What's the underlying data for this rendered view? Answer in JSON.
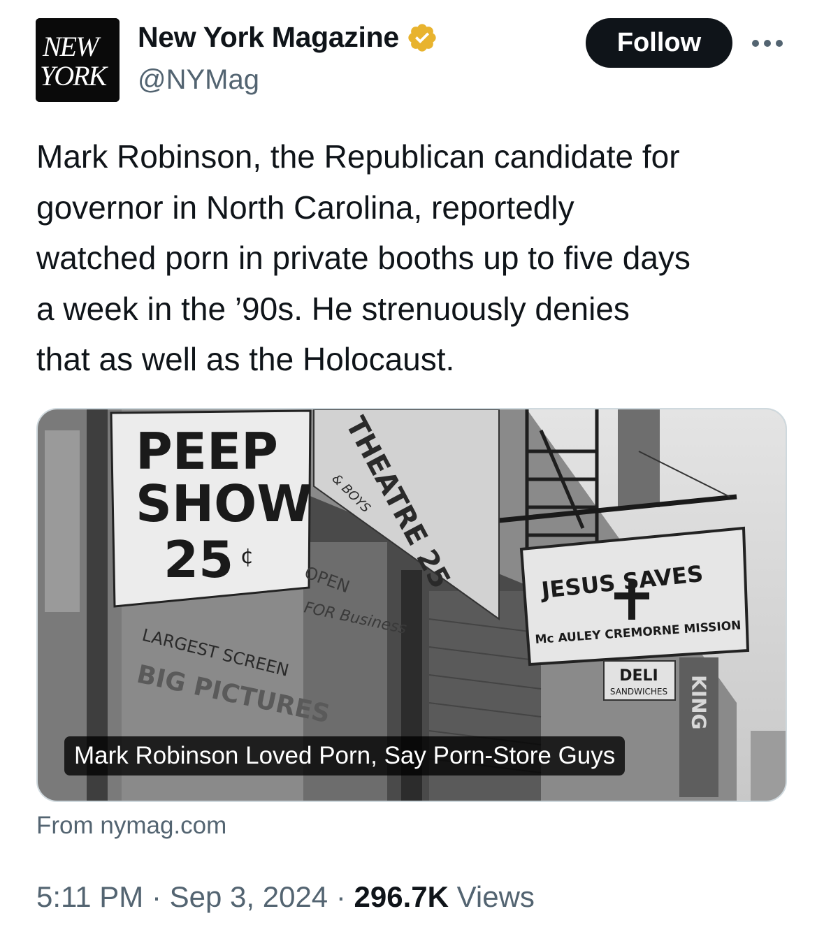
{
  "tweet": {
    "author": {
      "display_name": "New York Magazine",
      "handle": "@NYMag",
      "verified_badge": "gold-verified-badge-icon",
      "avatar_logo_text": "NEW YORK"
    },
    "follow_label": "Follow",
    "more_icon": "more-horizontal-icon",
    "text": "Mark Robinson, the Republican candidate for\ngovernor in North Carolina, reportedly\nwatched porn in private booths up to five days\na week in the ’90s. He strenuously denies\nthat as well as the Holocaust.",
    "card": {
      "headline": "Mark Robinson Loved Porn, Say Porn-Store Guys",
      "source": "From nymag.com",
      "photo_signs": {
        "peep_show": [
          "PEEP",
          "SHOW",
          "25"
        ],
        "cent_symbol": "¢",
        "theatre": "THEATRE 25",
        "boys": "& BOYS",
        "open_for": "OPEN",
        "for_business": "FOR Business",
        "largest_screen": "LARGEST SCREEN",
        "big_pictures": "BIG PICTURES",
        "jesus_saves": "JESUS SAVES",
        "mission": "Mc AULEY CREMORNE MISSION",
        "deli": "DELI",
        "sandwiches": "SANDWICHES",
        "king": "KING"
      }
    },
    "meta": {
      "time": "5:11 PM",
      "separator": "·",
      "date": "Sep 3, 2024",
      "views_count": "296.7K",
      "views_label": "Views"
    },
    "colors": {
      "text": "#0f1419",
      "secondary": "#536471",
      "badge": "#e8b32e",
      "border": "#cfd9de"
    }
  }
}
